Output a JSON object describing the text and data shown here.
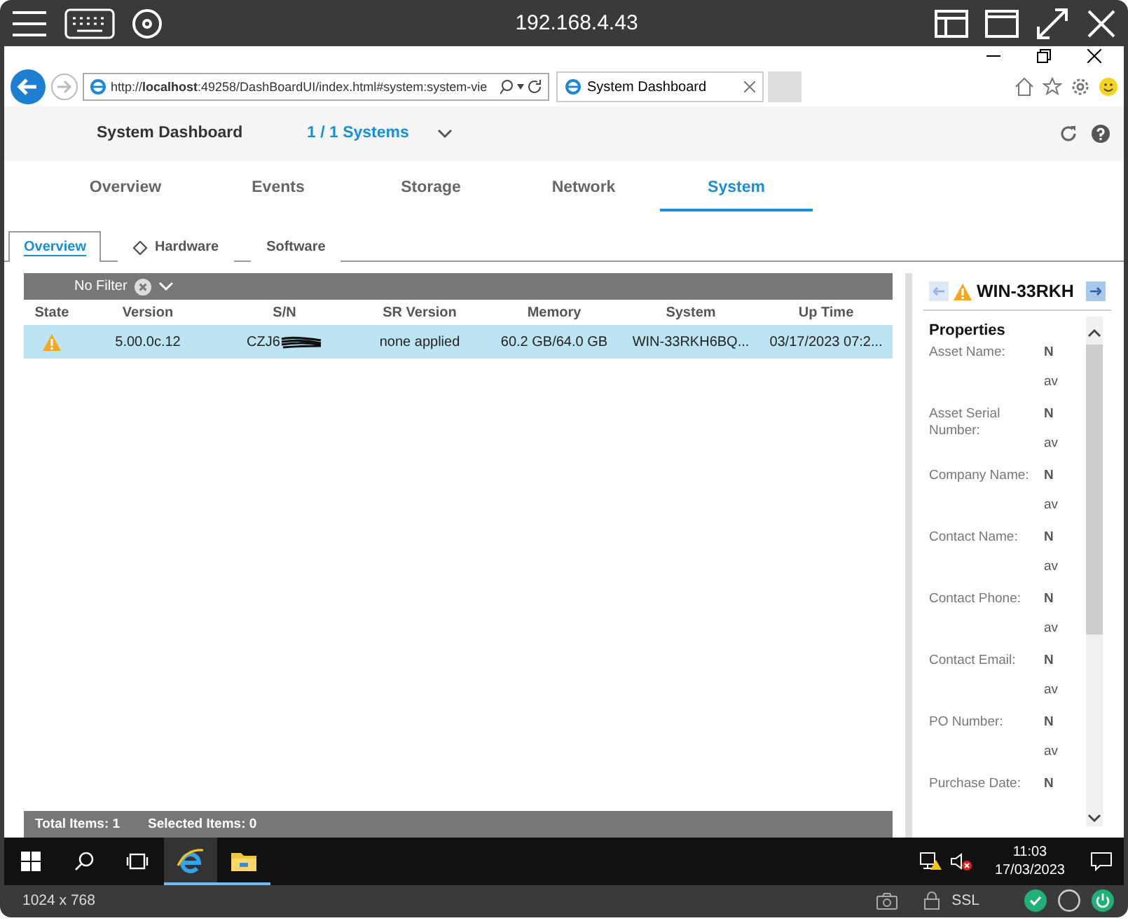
{
  "viewer": {
    "title": "192.168.4.43",
    "resolution": "1024 x 768",
    "security": "SSL"
  },
  "browser": {
    "address": "http://**localhost**:49258/DashBoardUI/index.html#system:system-vie",
    "tab_title": "System Dashboard"
  },
  "header": {
    "title": "System Dashboard",
    "systems": "1 / 1 Systems"
  },
  "main_tabs": [
    {
      "label": "Overview",
      "selected": false
    },
    {
      "label": "Events",
      "selected": false
    },
    {
      "label": "Storage",
      "selected": false
    },
    {
      "label": "Network",
      "selected": false
    },
    {
      "label": "System",
      "selected": true
    }
  ],
  "sub_tabs": [
    {
      "label": "Overview",
      "selected": true,
      "kind": "plain"
    },
    {
      "label": "Hardware",
      "selected": false,
      "kind": "diamond"
    },
    {
      "label": "Software",
      "selected": false,
      "kind": "plain"
    }
  ],
  "filter": {
    "label": "No Filter"
  },
  "table": {
    "columns": [
      "State",
      "Version",
      "S/N",
      "SR Version",
      "Memory",
      "System",
      "Up Time"
    ],
    "rows": [
      {
        "selected": true,
        "warning": true,
        "version": "5.00.0c.12",
        "sn": "CZJ6",
        "sn_redacted": true,
        "sr_version": "none applied",
        "memory": "60.2 GB/64.0 GB",
        "system": "WIN-33RKH6BQ...",
        "up_time": "03/17/2023 07:2..."
      }
    ]
  },
  "footer": {
    "total": "Total Items: 1",
    "selected": "Selected Items: 0"
  },
  "detail": {
    "title": "WIN-33RKH",
    "warning": true,
    "section": "Properties",
    "properties": [
      {
        "label": "Asset Name:",
        "value": [
          "N",
          "av"
        ]
      },
      {
        "label": "Asset Serial Number:",
        "value": [
          "N",
          "av"
        ]
      },
      {
        "label": "Company Name:",
        "value": [
          "N",
          "av"
        ]
      },
      {
        "label": "Contact Name:",
        "value": [
          "N",
          "av"
        ]
      },
      {
        "label": "Contact Phone:",
        "value": [
          "N",
          "av"
        ]
      },
      {
        "label": "Contact Email:",
        "value": [
          "N",
          "av"
        ]
      },
      {
        "label": "PO Number:",
        "value": [
          "N",
          "av"
        ]
      },
      {
        "label": "Purchase Date:",
        "value": [
          "N"
        ]
      }
    ]
  },
  "taskbar": {
    "apps": [
      {
        "kind": "browser",
        "selected": true
      },
      {
        "kind": "folder",
        "selected": false
      }
    ],
    "time": "11:03",
    "date": "17/03/2023"
  }
}
